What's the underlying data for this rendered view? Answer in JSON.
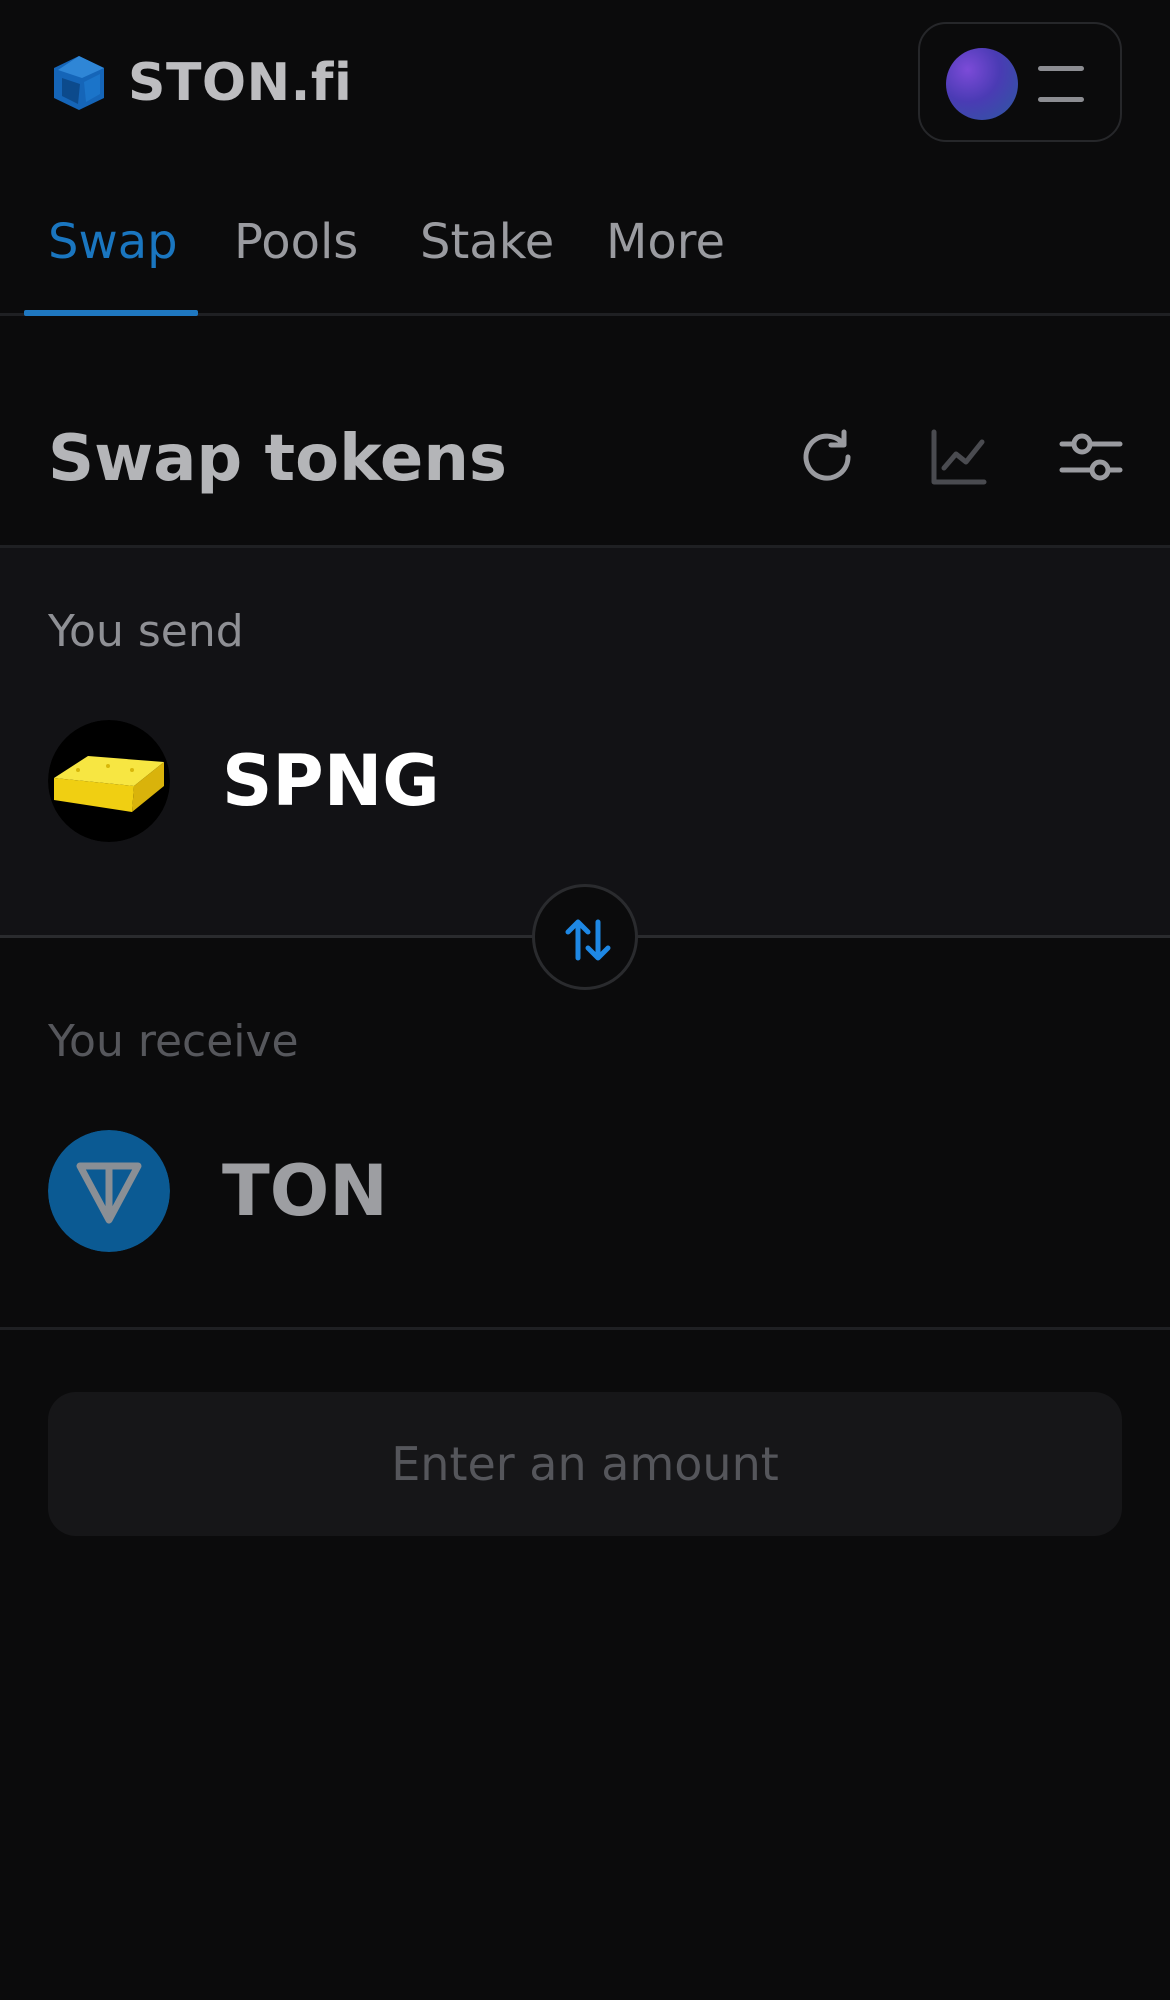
{
  "brand": {
    "name": "STON.fi"
  },
  "header": {
    "menu_icon": "hamburger-icon",
    "avatar": "wallet-avatar"
  },
  "tabs": [
    {
      "label": "Swap",
      "active": true
    },
    {
      "label": "Pools",
      "active": false
    },
    {
      "label": "Stake",
      "active": false
    },
    {
      "label": "More",
      "active": false
    }
  ],
  "swap": {
    "title": "Swap tokens",
    "actions": [
      "refresh-icon",
      "chart-icon",
      "settings-sliders-icon"
    ]
  },
  "send": {
    "label": "You send",
    "token": "SPNG"
  },
  "receive": {
    "label": "You receive",
    "token": "TON"
  },
  "button": {
    "label": "Enter an amount"
  },
  "colors": {
    "accent": "#1a76c0",
    "background": "#0b0b0c",
    "panel": "#121215"
  }
}
